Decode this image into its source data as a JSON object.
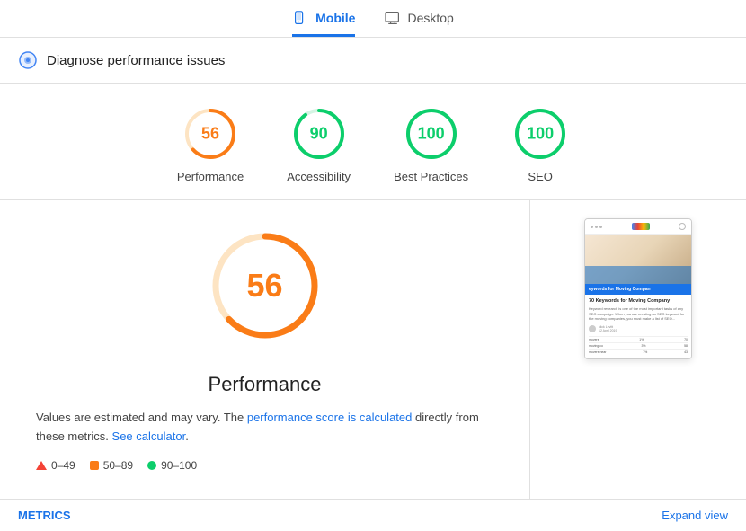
{
  "tabs": [
    {
      "id": "mobile",
      "label": "Mobile",
      "active": true
    },
    {
      "id": "desktop",
      "label": "Desktop",
      "active": false
    }
  ],
  "diagnose": {
    "title": "Diagnose performance issues"
  },
  "scores": [
    {
      "id": "performance",
      "value": 56,
      "label": "Performance",
      "color": "#fa7c17",
      "track_color": "#fde4c3",
      "dash": 63,
      "gap": 100
    },
    {
      "id": "accessibility",
      "value": 90,
      "label": "Accessibility",
      "color": "#0cce6b",
      "track_color": "#d4f4e3",
      "dash": 85,
      "gap": 100
    },
    {
      "id": "best-practices",
      "value": 100,
      "label": "Best Practices",
      "color": "#0cce6b",
      "track_color": "#d4f4e3",
      "dash": 100,
      "gap": 100
    },
    {
      "id": "seo",
      "value": 100,
      "label": "SEO",
      "color": "#0cce6b",
      "track_color": "#d4f4e3",
      "dash": 100,
      "gap": 100
    }
  ],
  "performance_panel": {
    "score": 56,
    "title": "Performance",
    "description_start": "Values are estimated and may vary. The ",
    "description_link1": "performance score is calculated",
    "description_link1_href": "#",
    "description_middle": " directly from these metrics. ",
    "description_link2": "See calculator",
    "description_link2_href": "#",
    "description_end": ".",
    "legend": [
      {
        "type": "triangle",
        "range": "0–49"
      },
      {
        "type": "square",
        "range": "50–89"
      },
      {
        "type": "dot",
        "range": "90–100"
      }
    ]
  },
  "bottom_bar": {
    "metrics_label": "METRICS",
    "expand_label": "Expand view"
  },
  "preview": {
    "title_bar": "eywords for Moving Compan",
    "article_title": "70 Keywords for Moving Company",
    "article_text": "Keyword research is one of the most important tasks of any SEO campaign. When you are creating an SEO keyword for the moving companies, you must make a list of SEO...",
    "author": "Nick Levitt",
    "date": "12 April 2019"
  }
}
